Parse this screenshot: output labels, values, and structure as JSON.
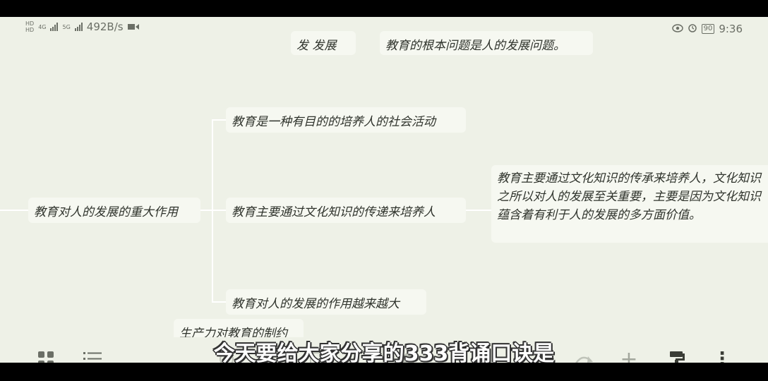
{
  "status": {
    "net_speed": "492B/s",
    "hd1": "HD",
    "hd2": "HD",
    "sig1": "4G",
    "sig2": "5G",
    "battery": "90",
    "time": "9:36"
  },
  "mindmap": {
    "top_left_fragment": "发   发展",
    "top_right_fragment": "教育的根本问题是人的发展问题。",
    "central_node": "教育对人的发展的重大作用",
    "child_1": "教育是一种有目的的培养人的社会活动",
    "child_2": "教育主要通过文化知识的传递来培养人",
    "child_3": "教育对人的发展的作用越来越大",
    "detail_node": "教育主要通过文化知识的传承来培养人，文化知识之所以对人的发展至关重要，主要是因为文化知识蕴含着有利于人的发展的多方面价值。",
    "bottom_fragment": "生产力对教育的制约"
  },
  "toolbar": {
    "grid_icon": "grid-icon",
    "list_icon": "list-icon",
    "redo_icon": "redo-icon",
    "add_label": "+",
    "format_icon": "format-paint-icon",
    "more_label": "⋮"
  },
  "subtitle": "今天要给大家分享的333背诵口诀是",
  "colors": {
    "background": "#eef1e7",
    "node_bg": "#f6f8f1",
    "text": "#2f332c",
    "icon": "#6b6f66"
  }
}
